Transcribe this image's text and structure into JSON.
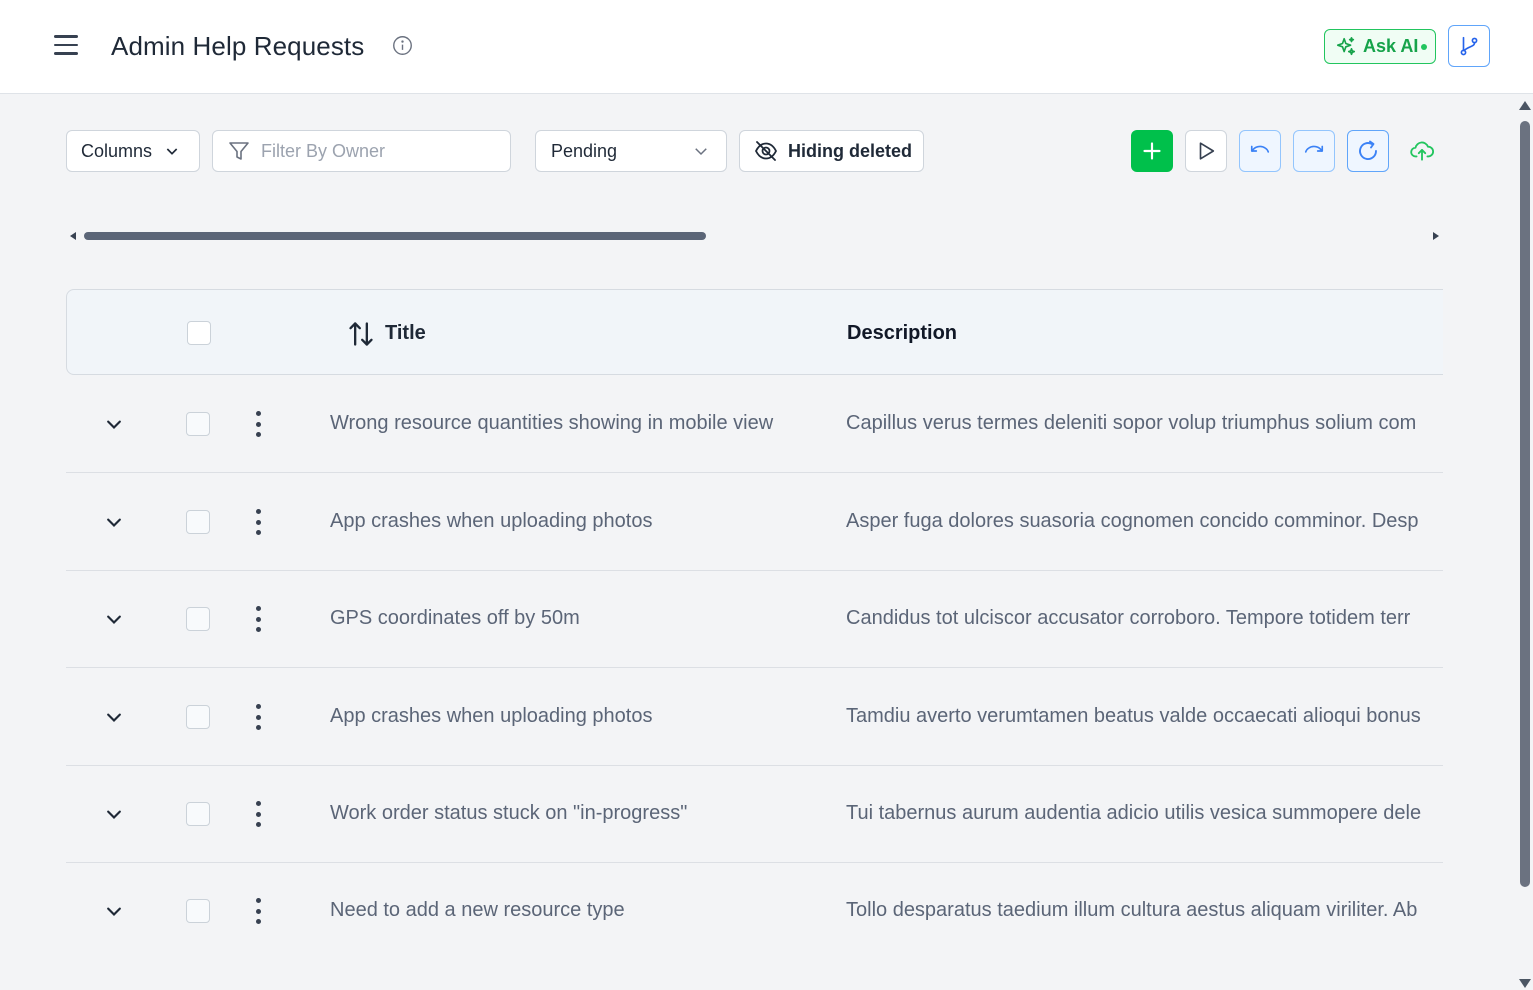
{
  "header": {
    "title": "Admin Help Requests",
    "ask_ai_label": "Ask AI"
  },
  "toolbar": {
    "columns_label": "Columns",
    "filter_placeholder": "Filter By Owner",
    "filter_value": "",
    "status_selected": "Pending",
    "hiding_deleted_label": "Hiding deleted"
  },
  "colors": {
    "add_button": "#00c04b",
    "accent_blue": "#60a5fa",
    "ai_green": "#16a34a"
  },
  "table": {
    "columns": [
      "Title",
      "Description"
    ],
    "rows": [
      {
        "title": "Wrong resource quantities showing in mobile view",
        "description": "Capillus verus termes deleniti sopor volup triumphus solium com"
      },
      {
        "title": "App crashes when uploading photos",
        "description": "Asper fuga dolores suasoria cognomen concido comminor. Desp"
      },
      {
        "title": "GPS coordinates off by 50m",
        "description": "Candidus tot ulciscor accusator corroboro. Tempore totidem terr"
      },
      {
        "title": "App crashes when uploading photos",
        "description": "Tamdiu averto verumtamen beatus valde occaecati alioqui bonus"
      },
      {
        "title": "Work order status stuck on \"in-progress\"",
        "description": "Tui tabernus aurum audentia adicio utilis vesica summopere dele"
      },
      {
        "title": "Need to add a new resource type",
        "description": "Tollo desparatus taedium illum cultura aestus aliquam viriliter. Ab"
      }
    ]
  }
}
